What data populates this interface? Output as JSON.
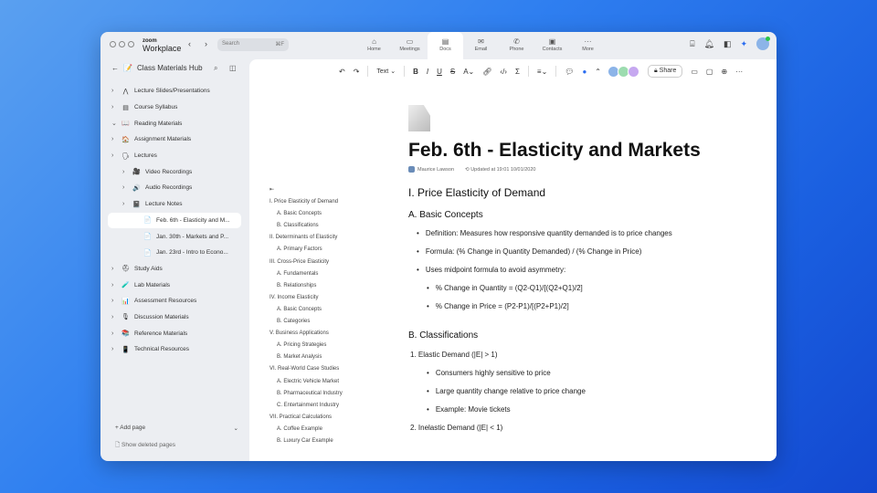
{
  "app": {
    "logo_top": "zoom",
    "logo_bottom": "Workplace",
    "search_placeholder": "Search",
    "search_shortcut": "⌘F"
  },
  "tabs": [
    {
      "label": "Home",
      "icon": "⌂"
    },
    {
      "label": "Meetings",
      "icon": "▭"
    },
    {
      "label": "Docs",
      "icon": "▤",
      "active": true
    },
    {
      "label": "Email",
      "icon": "✉"
    },
    {
      "label": "Phone",
      "icon": "✆"
    },
    {
      "label": "Contacts",
      "icon": "▣"
    },
    {
      "label": "More",
      "icon": "···"
    }
  ],
  "sidebar": {
    "title": "Class Materials Hub",
    "items": [
      {
        "label": "Lecture Slides/Presentations",
        "icon": "⋀",
        "chev": "›",
        "level": 0
      },
      {
        "label": "Course Syllabus",
        "icon": "▤",
        "chev": "›",
        "level": 0
      },
      {
        "label": "Reading Materials",
        "icon": "📖",
        "chev": "⌄",
        "level": 0
      },
      {
        "label": "Assignment Materials",
        "icon": "🏠",
        "chev": "›",
        "level": 0
      },
      {
        "label": "Lectures",
        "icon": "🗣",
        "chev": "›",
        "level": 0
      },
      {
        "label": "Video Recordings",
        "icon": "🎥",
        "chev": "›",
        "level": 1
      },
      {
        "label": "Audio Recordings",
        "icon": "🔊",
        "chev": "›",
        "level": 1
      },
      {
        "label": "Lecture Notes",
        "icon": "📓",
        "chev": "›",
        "level": 1
      },
      {
        "label": "Feb. 6th - Elasticity and M...",
        "icon": "📄",
        "chev": "",
        "level": 2,
        "selected": true
      },
      {
        "label": "Jan. 30th - Markets and P...",
        "icon": "📄",
        "chev": "",
        "level": 2
      },
      {
        "label": "Jan. 23rd - Intro to Econo...",
        "icon": "📄",
        "chev": "",
        "level": 2
      },
      {
        "label": "Study Aids",
        "icon": "⛑",
        "chev": "›",
        "level": 0
      },
      {
        "label": "Lab Materials",
        "icon": "🧪",
        "chev": "›",
        "level": 0
      },
      {
        "label": "Assessment Resources",
        "icon": "📊",
        "chev": "›",
        "level": 0
      },
      {
        "label": "Discussion Materials",
        "icon": "🎙",
        "chev": "›",
        "level": 0
      },
      {
        "label": "Reference Materials",
        "icon": "📚",
        "chev": "›",
        "level": 0
      },
      {
        "label": "Technical Resources",
        "icon": "📱",
        "chev": "›",
        "level": 0
      }
    ],
    "add_page": "Add page",
    "show_deleted": "Show deleted pages"
  },
  "toolbar": {
    "text_style": "Text",
    "share": "Share"
  },
  "outline": [
    {
      "t": "I. Price Elasticity of Demand",
      "sub": false
    },
    {
      "t": "A. Basic Concepts",
      "sub": true
    },
    {
      "t": "B. Classifications",
      "sub": true
    },
    {
      "t": "II. Determinants of Elasticity",
      "sub": false
    },
    {
      "t": "A. Primary Factors",
      "sub": true
    },
    {
      "t": "III. Cross-Price Elasticity",
      "sub": false
    },
    {
      "t": "A. Fundamentals",
      "sub": true
    },
    {
      "t": "B. Relationships",
      "sub": true
    },
    {
      "t": "IV. Income Elasticity",
      "sub": false
    },
    {
      "t": "A. Basic Concepts",
      "sub": true
    },
    {
      "t": "B. Categories",
      "sub": true
    },
    {
      "t": "V. Business Applications",
      "sub": false
    },
    {
      "t": "A. Pricing Strategies",
      "sub": true
    },
    {
      "t": "B. Market Analysis",
      "sub": true
    },
    {
      "t": "VI. Real-World Case Studies",
      "sub": false
    },
    {
      "t": "A. Electric Vehicle Market",
      "sub": true
    },
    {
      "t": "B. Pharmaceutical Industry",
      "sub": true
    },
    {
      "t": "C. Entertainment Industry",
      "sub": true
    },
    {
      "t": "VII. Practical Calculations",
      "sub": false
    },
    {
      "t": "A. Coffee Example",
      "sub": true
    },
    {
      "t": "B. Luxury Car Example",
      "sub": true
    }
  ],
  "doc": {
    "title": "Feb. 6th - Elasticity and Markets",
    "author": "Maurice Lawson",
    "updated": "Updated at 19:01 10/01/2020",
    "h_1": "I. Price Elasticity of Demand",
    "h_a": "A. Basic Concepts",
    "b1": "Definition: Measures how responsive quantity demanded is to price changes",
    "b2": "Formula: (% Change in Quantity Demanded) / (% Change in Price)",
    "b3": "Uses midpoint formula to avoid asymmetry:",
    "b3a": "% Change in Quantity = (Q2-Q1)/[(Q2+Q1)/2]",
    "b3b": "% Change in Price = (P2-P1)/[(P2+P1)/2]",
    "h_b": "B. Classifications",
    "n1": "1. Elastic Demand (|E| > 1)",
    "n1a": "Consumers highly sensitive to price",
    "n1b": "Large quantity change relative to price change",
    "n1c": "Example: Movie tickets",
    "n2": "2. Inelastic Demand (|E| < 1)"
  }
}
